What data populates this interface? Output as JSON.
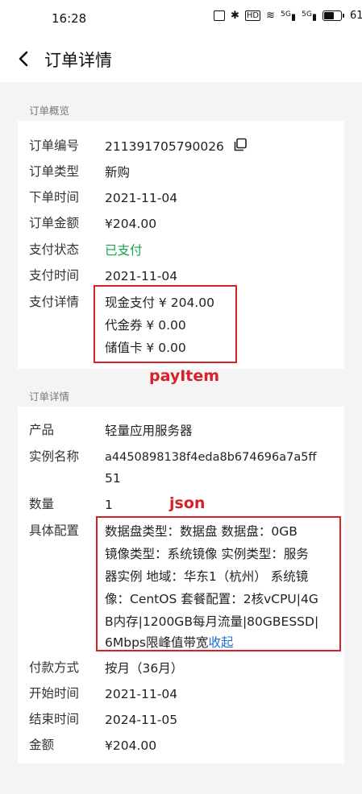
{
  "status_bar": {
    "time": "16:28",
    "battery": "61%",
    "battery_level": 0.61,
    "net1": "5G",
    "net2": "5G"
  },
  "nav": {
    "title": "订单详情"
  },
  "overview": {
    "section_title": "订单概览",
    "rows": [
      {
        "key": "订单编号",
        "value": "211391705790026"
      },
      {
        "key": "订单类型",
        "value": "新购"
      },
      {
        "key": "下单时间",
        "value": "2021-11-04"
      },
      {
        "key": "订单金额",
        "value": "¥204.00"
      },
      {
        "key": "支付状态",
        "value": "已支付"
      },
      {
        "key": "支付时间",
        "value": "2021-11-04"
      }
    ],
    "pay_detail": {
      "key": "支付详情",
      "lines": [
        "现金支付 ¥ 204.00",
        "代金券 ¥ 0.00",
        "储值卡 ¥ 0.00"
      ]
    }
  },
  "annotation_payitem": "payItem",
  "details": {
    "section_title": "订单详情",
    "product": {
      "key": "产品",
      "value": "轻量应用服务器"
    },
    "instance": {
      "key": "实例名称",
      "line1": "a4450898138f4eda8b674696a7a5ff",
      "line2": "51"
    },
    "quantity": {
      "key": "数量",
      "value": "1"
    },
    "config": {
      "key": "具体配置",
      "lines": [
        "数据盘类型：数据盘 数据盘：0GB",
        "镜像类型：系统镜像 实例类型：服务",
        "器实例 地域：华东1（杭州） 系统镜",
        "像：CentOS 套餐配置：2核vCPU|4G",
        "B内存|1200GB每月流量|80GBESSD|",
        "6Mbps限峰值带宽"
      ],
      "collapse_link": "收起"
    },
    "payment_method": {
      "key": "付款方式",
      "value": "按月（36月）"
    },
    "start_time": {
      "key": "开始时间",
      "value": "2021-11-04"
    },
    "end_time": {
      "key": "结束时间",
      "value": "2024-11-05"
    },
    "amount": {
      "key": "金额",
      "value": "¥204.00"
    }
  },
  "annotation_json": "json"
}
